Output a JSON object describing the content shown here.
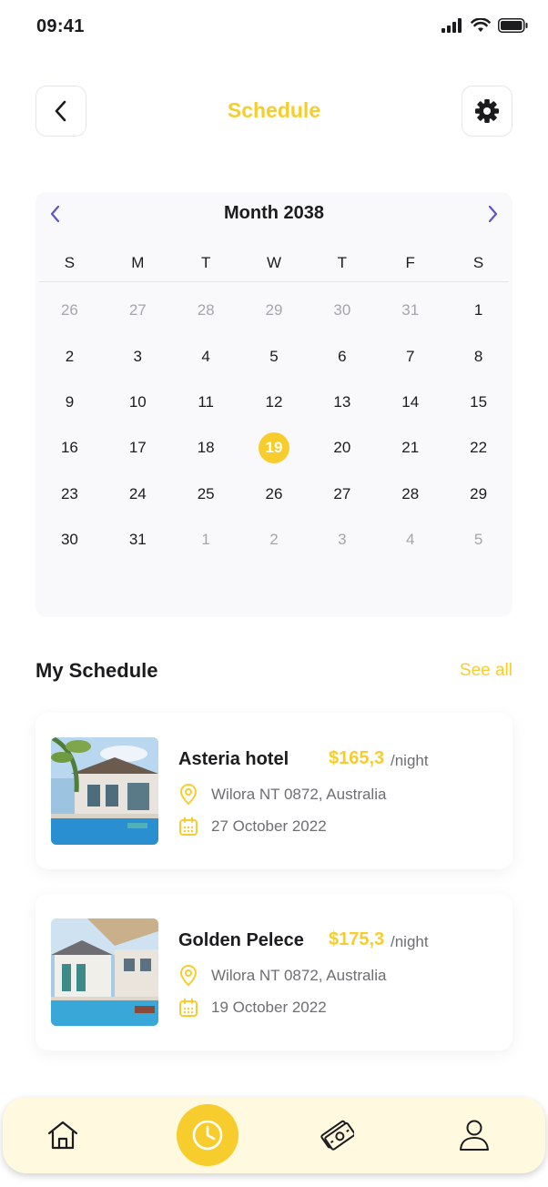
{
  "status": {
    "time": "09:41"
  },
  "header": {
    "title": "Schedule"
  },
  "calendar": {
    "month_label": "Month 2038",
    "weekdays": [
      "S",
      "M",
      "T",
      "W",
      "T",
      "F",
      "S"
    ],
    "selected_day": "19",
    "days": [
      {
        "label": "26",
        "muted": true
      },
      {
        "label": "27",
        "muted": true
      },
      {
        "label": "28",
        "muted": true
      },
      {
        "label": "29",
        "muted": true
      },
      {
        "label": "30",
        "muted": true
      },
      {
        "label": "31",
        "muted": true
      },
      {
        "label": "1",
        "muted": false
      },
      {
        "label": "2",
        "muted": false
      },
      {
        "label": "3",
        "muted": false
      },
      {
        "label": "4",
        "muted": false
      },
      {
        "label": "5",
        "muted": false
      },
      {
        "label": "6",
        "muted": false
      },
      {
        "label": "7",
        "muted": false
      },
      {
        "label": "8",
        "muted": false
      },
      {
        "label": "9",
        "muted": false
      },
      {
        "label": "10",
        "muted": false
      },
      {
        "label": "11",
        "muted": false
      },
      {
        "label": "12",
        "muted": false
      },
      {
        "label": "13",
        "muted": false
      },
      {
        "label": "14",
        "muted": false
      },
      {
        "label": "15",
        "muted": false
      },
      {
        "label": "16",
        "muted": false
      },
      {
        "label": "17",
        "muted": false
      },
      {
        "label": "18",
        "muted": false
      },
      {
        "label": "19",
        "muted": false
      },
      {
        "label": "20",
        "muted": false
      },
      {
        "label": "21",
        "muted": false
      },
      {
        "label": "22",
        "muted": false
      },
      {
        "label": "23",
        "muted": false
      },
      {
        "label": "24",
        "muted": false
      },
      {
        "label": "25",
        "muted": false
      },
      {
        "label": "26",
        "muted": false
      },
      {
        "label": "27",
        "muted": false
      },
      {
        "label": "28",
        "muted": false
      },
      {
        "label": "29",
        "muted": false
      },
      {
        "label": "30",
        "muted": false
      },
      {
        "label": "31",
        "muted": false
      },
      {
        "label": "1",
        "muted": true
      },
      {
        "label": "2",
        "muted": true
      },
      {
        "label": "3",
        "muted": true
      },
      {
        "label": "4",
        "muted": true
      },
      {
        "label": "5",
        "muted": true
      }
    ]
  },
  "schedule": {
    "title": "My Schedule",
    "see_all": "See all",
    "items": [
      {
        "name": "Asteria hotel",
        "price": "$165,3",
        "per": "/night",
        "location": "Wilora NT 0872, Australia",
        "date": "27 October 2022"
      },
      {
        "name": "Golden Pelece",
        "price": "$175,3",
        "per": "/night",
        "location": "Wilora NT 0872, Australia",
        "date": "19 October 2022"
      }
    ]
  },
  "colors": {
    "accent": "#f7cd2e",
    "nav_bg": "#fff9df",
    "calendar_bg": "#f9f9fc",
    "arrow": "#5b55c9"
  },
  "icons": {
    "nav": [
      "home-icon",
      "clock-icon",
      "money-icon",
      "profile-icon"
    ],
    "header": [
      "chevron-left-icon",
      "gear-icon"
    ]
  }
}
